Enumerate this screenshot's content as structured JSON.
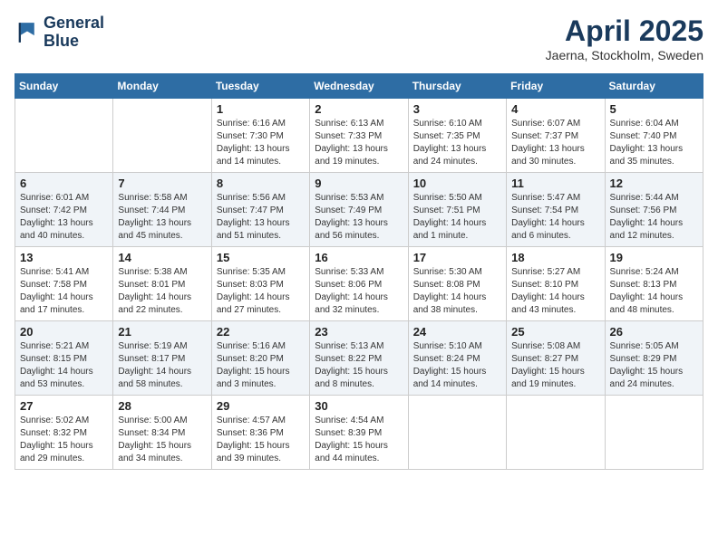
{
  "header": {
    "logo_line1": "General",
    "logo_line2": "Blue",
    "month_year": "April 2025",
    "location": "Jaerna, Stockholm, Sweden"
  },
  "weekdays": [
    "Sunday",
    "Monday",
    "Tuesday",
    "Wednesday",
    "Thursday",
    "Friday",
    "Saturday"
  ],
  "weeks": [
    [
      {
        "day": "",
        "info": ""
      },
      {
        "day": "",
        "info": ""
      },
      {
        "day": "1",
        "info": "Sunrise: 6:16 AM\nSunset: 7:30 PM\nDaylight: 13 hours\nand 14 minutes."
      },
      {
        "day": "2",
        "info": "Sunrise: 6:13 AM\nSunset: 7:33 PM\nDaylight: 13 hours\nand 19 minutes."
      },
      {
        "day": "3",
        "info": "Sunrise: 6:10 AM\nSunset: 7:35 PM\nDaylight: 13 hours\nand 24 minutes."
      },
      {
        "day": "4",
        "info": "Sunrise: 6:07 AM\nSunset: 7:37 PM\nDaylight: 13 hours\nand 30 minutes."
      },
      {
        "day": "5",
        "info": "Sunrise: 6:04 AM\nSunset: 7:40 PM\nDaylight: 13 hours\nand 35 minutes."
      }
    ],
    [
      {
        "day": "6",
        "info": "Sunrise: 6:01 AM\nSunset: 7:42 PM\nDaylight: 13 hours\nand 40 minutes."
      },
      {
        "day": "7",
        "info": "Sunrise: 5:58 AM\nSunset: 7:44 PM\nDaylight: 13 hours\nand 45 minutes."
      },
      {
        "day": "8",
        "info": "Sunrise: 5:56 AM\nSunset: 7:47 PM\nDaylight: 13 hours\nand 51 minutes."
      },
      {
        "day": "9",
        "info": "Sunrise: 5:53 AM\nSunset: 7:49 PM\nDaylight: 13 hours\nand 56 minutes."
      },
      {
        "day": "10",
        "info": "Sunrise: 5:50 AM\nSunset: 7:51 PM\nDaylight: 14 hours\nand 1 minute."
      },
      {
        "day": "11",
        "info": "Sunrise: 5:47 AM\nSunset: 7:54 PM\nDaylight: 14 hours\nand 6 minutes."
      },
      {
        "day": "12",
        "info": "Sunrise: 5:44 AM\nSunset: 7:56 PM\nDaylight: 14 hours\nand 12 minutes."
      }
    ],
    [
      {
        "day": "13",
        "info": "Sunrise: 5:41 AM\nSunset: 7:58 PM\nDaylight: 14 hours\nand 17 minutes."
      },
      {
        "day": "14",
        "info": "Sunrise: 5:38 AM\nSunset: 8:01 PM\nDaylight: 14 hours\nand 22 minutes."
      },
      {
        "day": "15",
        "info": "Sunrise: 5:35 AM\nSunset: 8:03 PM\nDaylight: 14 hours\nand 27 minutes."
      },
      {
        "day": "16",
        "info": "Sunrise: 5:33 AM\nSunset: 8:06 PM\nDaylight: 14 hours\nand 32 minutes."
      },
      {
        "day": "17",
        "info": "Sunrise: 5:30 AM\nSunset: 8:08 PM\nDaylight: 14 hours\nand 38 minutes."
      },
      {
        "day": "18",
        "info": "Sunrise: 5:27 AM\nSunset: 8:10 PM\nDaylight: 14 hours\nand 43 minutes."
      },
      {
        "day": "19",
        "info": "Sunrise: 5:24 AM\nSunset: 8:13 PM\nDaylight: 14 hours\nand 48 minutes."
      }
    ],
    [
      {
        "day": "20",
        "info": "Sunrise: 5:21 AM\nSunset: 8:15 PM\nDaylight: 14 hours\nand 53 minutes."
      },
      {
        "day": "21",
        "info": "Sunrise: 5:19 AM\nSunset: 8:17 PM\nDaylight: 14 hours\nand 58 minutes."
      },
      {
        "day": "22",
        "info": "Sunrise: 5:16 AM\nSunset: 8:20 PM\nDaylight: 15 hours\nand 3 minutes."
      },
      {
        "day": "23",
        "info": "Sunrise: 5:13 AM\nSunset: 8:22 PM\nDaylight: 15 hours\nand 8 minutes."
      },
      {
        "day": "24",
        "info": "Sunrise: 5:10 AM\nSunset: 8:24 PM\nDaylight: 15 hours\nand 14 minutes."
      },
      {
        "day": "25",
        "info": "Sunrise: 5:08 AM\nSunset: 8:27 PM\nDaylight: 15 hours\nand 19 minutes."
      },
      {
        "day": "26",
        "info": "Sunrise: 5:05 AM\nSunset: 8:29 PM\nDaylight: 15 hours\nand 24 minutes."
      }
    ],
    [
      {
        "day": "27",
        "info": "Sunrise: 5:02 AM\nSunset: 8:32 PM\nDaylight: 15 hours\nand 29 minutes."
      },
      {
        "day": "28",
        "info": "Sunrise: 5:00 AM\nSunset: 8:34 PM\nDaylight: 15 hours\nand 34 minutes."
      },
      {
        "day": "29",
        "info": "Sunrise: 4:57 AM\nSunset: 8:36 PM\nDaylight: 15 hours\nand 39 minutes."
      },
      {
        "day": "30",
        "info": "Sunrise: 4:54 AM\nSunset: 8:39 PM\nDaylight: 15 hours\nand 44 minutes."
      },
      {
        "day": "",
        "info": ""
      },
      {
        "day": "",
        "info": ""
      },
      {
        "day": "",
        "info": ""
      }
    ]
  ]
}
